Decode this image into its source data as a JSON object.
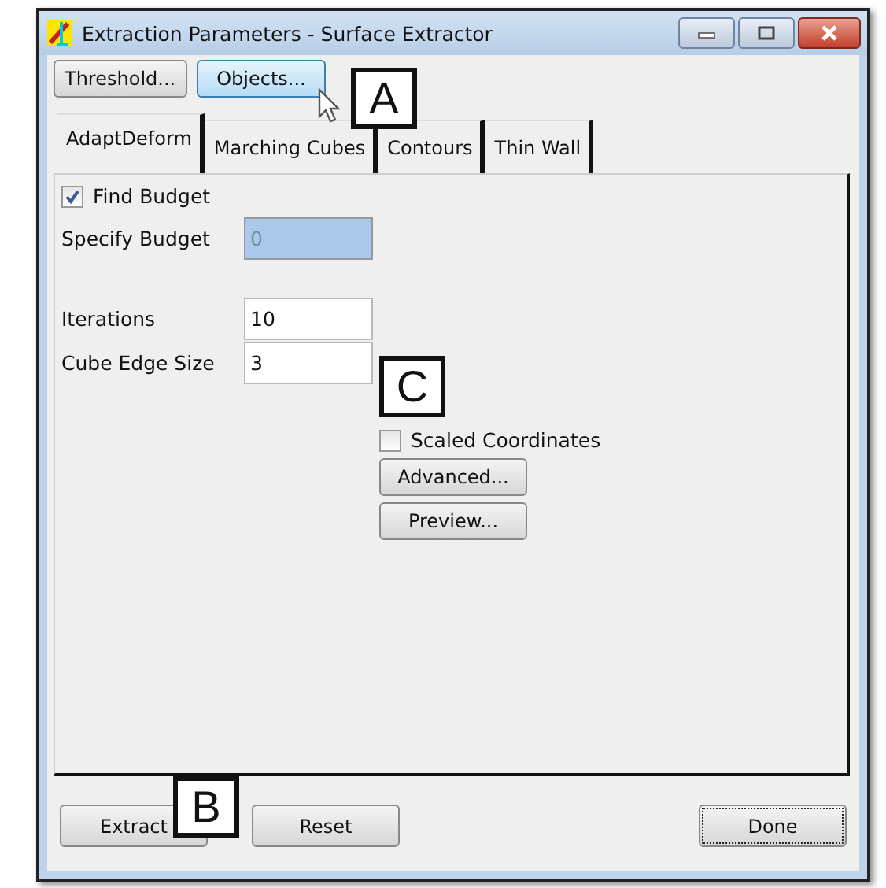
{
  "window": {
    "title": "Extraction Parameters - Surface Extractor"
  },
  "top_buttons": [
    {
      "label": "Threshold...",
      "hovered": false
    },
    {
      "label": "Objects...",
      "hovered": true
    }
  ],
  "tabs": [
    {
      "label": "AdaptDeform",
      "selected": true
    },
    {
      "label": "Marching Cubes",
      "selected": false
    },
    {
      "label": "Contours",
      "selected": false
    },
    {
      "label": "Thin Wall",
      "selected": false
    }
  ],
  "find_budget": {
    "label": "Find Budget",
    "checked": true
  },
  "fields": [
    {
      "label": "Specify Budget",
      "value": "0",
      "disabled": true
    },
    {
      "label": "Iterations",
      "value": "10",
      "disabled": false
    },
    {
      "label": "Cube Edge Size",
      "value": "3",
      "disabled": false
    }
  ],
  "scaled_coordinates": {
    "label": "Scaled Coordinates",
    "checked": false
  },
  "panel_buttons": [
    "Advanced...",
    "Preview..."
  ],
  "bottom_buttons": [
    {
      "label": "Extract",
      "focused": false
    },
    {
      "label": "Reset",
      "focused": false
    },
    {
      "label": "Done",
      "focused": true
    }
  ],
  "callouts": [
    "A",
    "B",
    "C"
  ]
}
